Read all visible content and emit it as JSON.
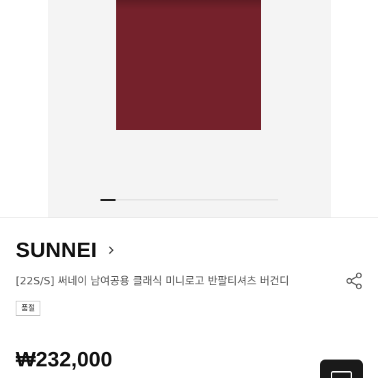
{
  "gallery": {
    "slide_index": 1,
    "product_color": "#75212b",
    "background_color": "#f4f4f4"
  },
  "product": {
    "brand": "SUNNEI",
    "title": "[22S/S] 써네이 남여공용 클래식 미니로고 반팔티셔츠 버건디",
    "tag": "품절",
    "price": "₩232,000"
  },
  "icons": {
    "brand_link": "chevron-right-icon",
    "share": "share-icon",
    "action": "bag-icon"
  }
}
